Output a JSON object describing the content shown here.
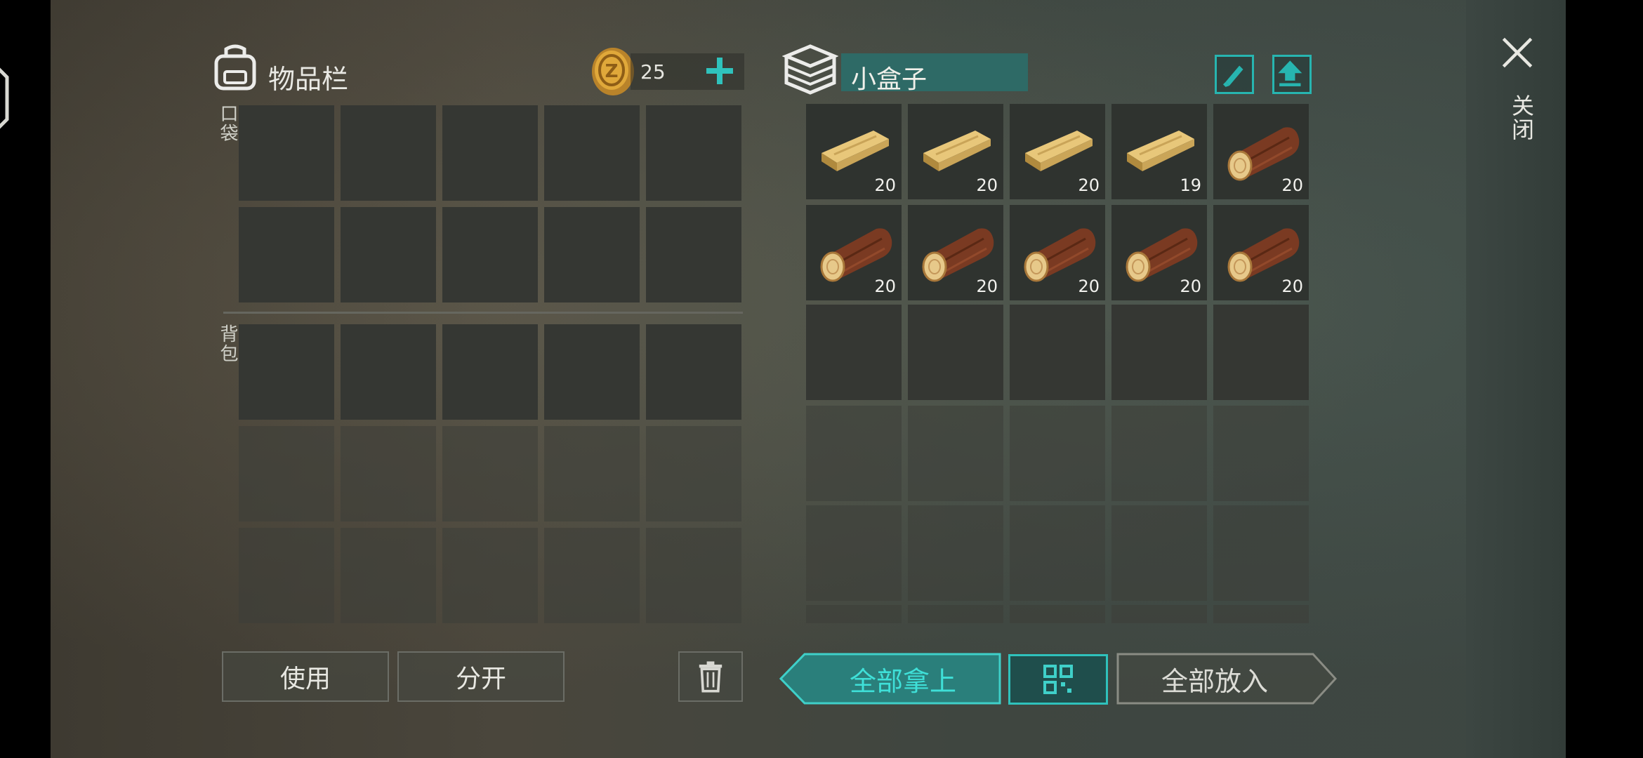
{
  "inventory": {
    "title": "物品栏",
    "coins": "25",
    "pocket_label": "口袋",
    "backpack_label": "背包"
  },
  "container": {
    "name": "小盒子",
    "items": [
      {
        "type": "plank",
        "count": "20"
      },
      {
        "type": "plank",
        "count": "20"
      },
      {
        "type": "plank",
        "count": "20"
      },
      {
        "type": "plank",
        "count": "19"
      },
      {
        "type": "log",
        "count": "20"
      },
      {
        "type": "log",
        "count": "20"
      },
      {
        "type": "log",
        "count": "20"
      },
      {
        "type": "log",
        "count": "20"
      },
      {
        "type": "log",
        "count": "20"
      },
      {
        "type": "log",
        "count": "20"
      }
    ]
  },
  "actions": {
    "use": "使用",
    "split": "分开",
    "take_all": "全部拿上",
    "put_all": "全部放入"
  },
  "close_label": "关闭",
  "icons": {
    "backpack": "backpack-icon",
    "coin": "coin-icon",
    "add": "plus-icon",
    "box": "box-icon",
    "rename": "edit-brush-icon",
    "upload": "upload-icon",
    "trash": "trash-icon",
    "grid": "grid-icon",
    "close": "close-icon"
  },
  "colors": {
    "accent": "#2fc2bc",
    "slot": "#353733",
    "name_field": "#2e6a66"
  }
}
